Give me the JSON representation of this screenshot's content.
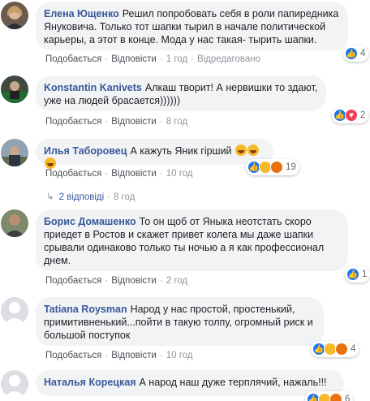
{
  "comments": [
    {
      "author": "Елена Ющенко",
      "text": "Решил попробовать себя в роли папиредника Януковича. Только тот шапки тырил в начале политической карьеры, а этот в конце. Мода у нас такая- тырить шапки.",
      "like_label": "Подобається",
      "reply_label": "Відповісти",
      "time": "1 год",
      "edited": "Відредаговано",
      "reaction_count": "4"
    },
    {
      "author": "Konstantin Kanivets",
      "text": "Алкаш творит! А нервишки то здают, уже на людей брасается))))))",
      "like_label": "Подобається",
      "reply_label": "Відповісти",
      "time": "8 год",
      "reaction_count": "2"
    },
    {
      "author": "Илья Таборовец",
      "text": "А кажуть Яник гірший",
      "like_label": "Подобається",
      "reply_label": "Відповісти",
      "time": "10 год",
      "reaction_count": "19",
      "replies_label": "2 відповіді",
      "replies_time": "8 год"
    },
    {
      "author": "Борис Домашенко",
      "text": "То он щоб от Яныка неотстать скоро приедет в Ростов и скажет привет колега мы даже шапки срывали одинаково только ты ночью а я как профессионал днем.",
      "like_label": "Подобається",
      "reply_label": "Відповісти",
      "time": "2 год",
      "reaction_count": "1"
    },
    {
      "author": "Tatiana Roysman",
      "text": "Народ у нас простой, простенький, примитивненький...пойти в такую толпу, огромный риск и большой поступок",
      "like_label": "Подобається",
      "reply_label": "Відповісти",
      "time": "10 год",
      "reaction_count": "4"
    },
    {
      "author": "Наталья Корецкая",
      "text": "А народ наш дуже терплячий, нажаль!!!",
      "reaction_count": "6"
    }
  ],
  "colors": {
    "author": "#385898",
    "bubble": "#f2f3f5",
    "meta": "#90949c",
    "like": "#1877f2",
    "love": "#f33e58",
    "haha": "#f7b928"
  }
}
